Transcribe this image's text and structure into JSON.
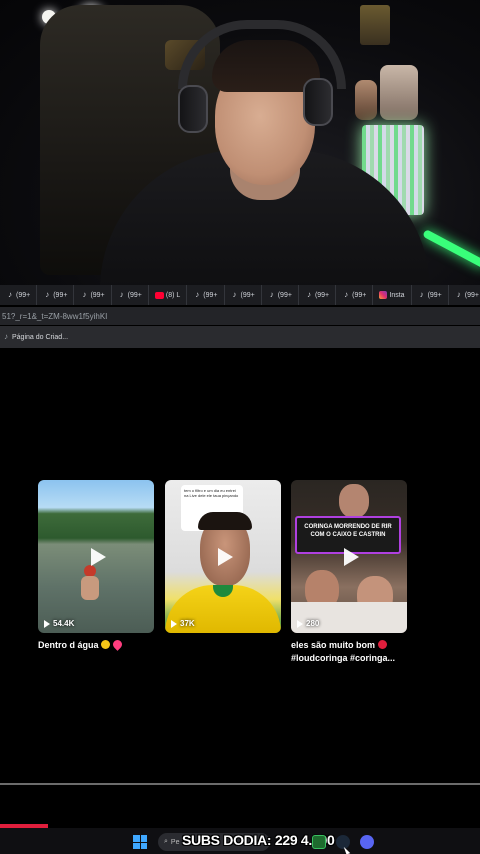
{
  "webcam": {},
  "browser": {
    "tabs": [
      {
        "icon": "tiktok-icon",
        "label": "(99+"
      },
      {
        "icon": "tiktok-icon",
        "label": "(99+"
      },
      {
        "icon": "tiktok-icon",
        "label": "(99+"
      },
      {
        "icon": "tiktok-icon",
        "label": "(99+"
      },
      {
        "icon": "youtube-icon",
        "label": "(8) L"
      },
      {
        "icon": "tiktok-icon",
        "label": "(99+"
      },
      {
        "icon": "tiktok-icon",
        "label": "(99+"
      },
      {
        "icon": "tiktok-icon",
        "label": "(99+"
      },
      {
        "icon": "tiktok-icon",
        "label": "(99+"
      },
      {
        "icon": "tiktok-icon",
        "label": "(99+"
      },
      {
        "icon": "instagram-icon",
        "label": "Insta"
      },
      {
        "icon": "tiktok-icon",
        "label": "(99+"
      },
      {
        "icon": "tiktok-icon",
        "label": "(99+"
      }
    ],
    "url_fragment": "51?_r=1&_t=ZM-8ww1f5yihKI",
    "bookmark_label": "Página do Criad..."
  },
  "videos": [
    {
      "views": "54.4K",
      "caption_line1": "Dentro d água",
      "caption_line2": ""
    },
    {
      "views": "37K",
      "overlay_text": "tem o filtro e um dia eu entrei na Live dele ele taua pinçando",
      "caption_line1": "",
      "caption_line2": ""
    },
    {
      "views": "280",
      "overlay_text": "CORINGA MORRENDO DE RIR COM O CAIXO E CASTRIN",
      "caption_line1": "eles são muito bom",
      "caption_line2": "#loudcoringa #coringa..."
    }
  ],
  "progress_fraction": 0.1,
  "taskbar": {
    "search_placeholder": "Pe",
    "subs_counter": "SUBS DODIA: 229 4.000"
  },
  "colors": {
    "accent_red": "#e01e3c",
    "neon_green": "#39ff7a",
    "windows_blue": "#3fa8ff"
  }
}
